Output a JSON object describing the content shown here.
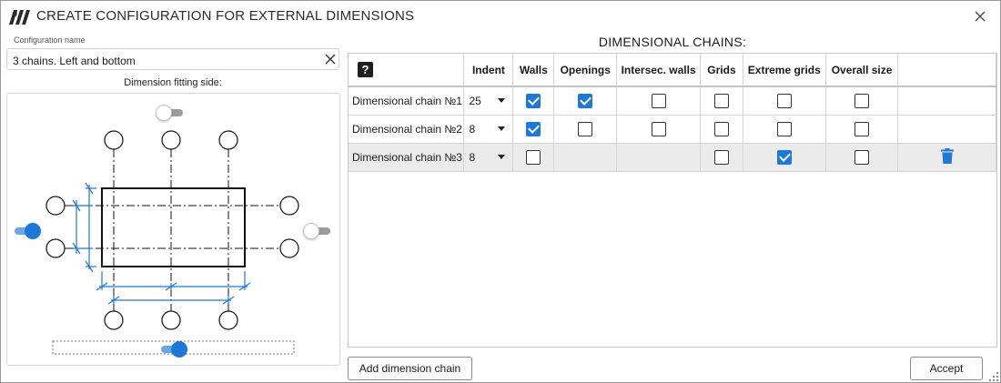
{
  "window": {
    "title": "CREATE CONFIGURATION FOR EXTERNAL DIMENSIONS"
  },
  "config": {
    "label": "Configuration name",
    "value": "3 chains. Left and bottom"
  },
  "fitting": {
    "label": "Dimension fitting side:",
    "toggles": {
      "top": false,
      "left": true,
      "right": false,
      "bottom": true
    }
  },
  "chains": {
    "title": "DIMENSIONAL CHAINS:",
    "help_symbol": "?",
    "columns": [
      "Indent",
      "Walls",
      "Openings",
      "Intersec. walls",
      "Grids",
      "Extreme grids",
      "Overall size"
    ],
    "rows": [
      {
        "name": "Dimensional chain №1",
        "indent": "25",
        "walls": true,
        "openings": true,
        "intersec_walls": false,
        "grids": false,
        "extreme_grids": false,
        "overall_size": false
      },
      {
        "name": "Dimensional chain №2",
        "indent": "8",
        "walls": true,
        "openings": false,
        "intersec_walls": false,
        "grids": false,
        "extreme_grids": false,
        "overall_size": false
      },
      {
        "name": "Dimensional chain №3",
        "indent": "8",
        "walls": false,
        "openings": null,
        "intersec_walls": null,
        "grids": false,
        "extreme_grids": true,
        "overall_size": false,
        "selected": true
      }
    ]
  },
  "buttons": {
    "add": "Add dimension chain",
    "accept": "Accept"
  },
  "colors": {
    "accent": "#1e78d7",
    "toggle_on_track": "#6aa6e6",
    "toggle_off_track": "#9c9c9c",
    "selected_row": "#ebebeb"
  }
}
